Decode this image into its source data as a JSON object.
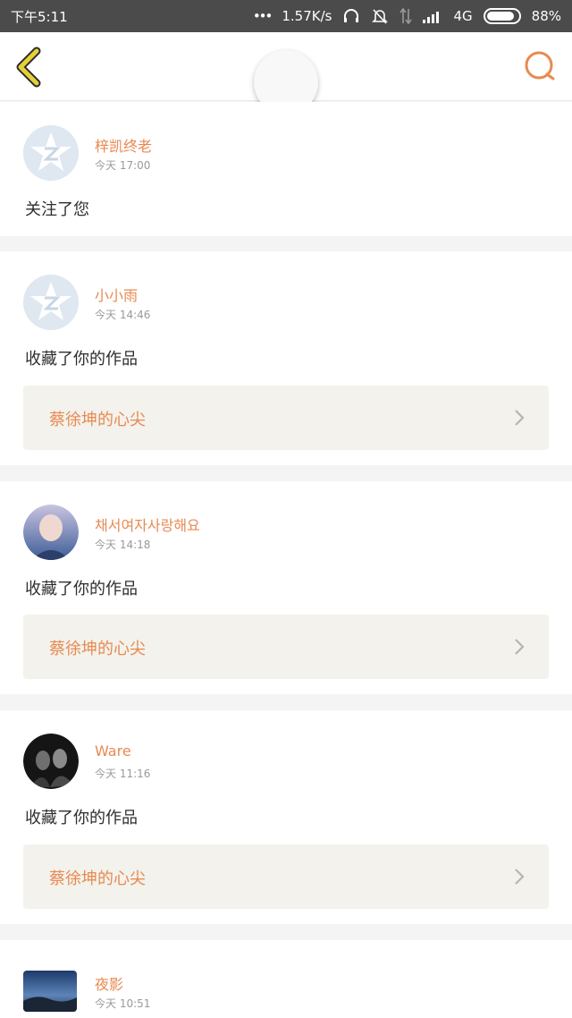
{
  "status_bar": {
    "time": "下午5:11",
    "dots": "•••",
    "speed": "1.57K/s",
    "network": "4G",
    "battery_percent": "88%",
    "battery_level": 0.88,
    "icons": [
      "headphone-icon",
      "mute-icon",
      "data-arrows-icon",
      "signal-icon",
      "battery-icon"
    ]
  },
  "header": {
    "back_icon": "back-chevron-icon",
    "search_icon": "search-icon",
    "accent_color": "#e88a52",
    "back_color": "#e6d03a"
  },
  "notifications": [
    {
      "username": "梓凯终老",
      "time": "今天 17:00",
      "action": "关注了您",
      "avatar": "qq-default-avatar"
    },
    {
      "username": "小小雨",
      "time": "今天 14:46",
      "action": "收藏了你的作品",
      "work_title": "蔡徐坤的心尖",
      "avatar": "qq-default-avatar"
    },
    {
      "username": "채서여자사랑해요",
      "time": "今天 14:18",
      "action": "收藏了你的作品",
      "work_title": "蔡徐坤的心尖",
      "avatar": "photo-avatar-blue"
    },
    {
      "username": "Ware",
      "time": "今天 11:16",
      "action": "收藏了你的作品",
      "work_title": "蔡徐坤的心尖",
      "avatar": "photo-avatar-dark"
    },
    {
      "username": "夜影",
      "time": "今天 10:51",
      "avatar": "photo-avatar-landscape"
    }
  ]
}
